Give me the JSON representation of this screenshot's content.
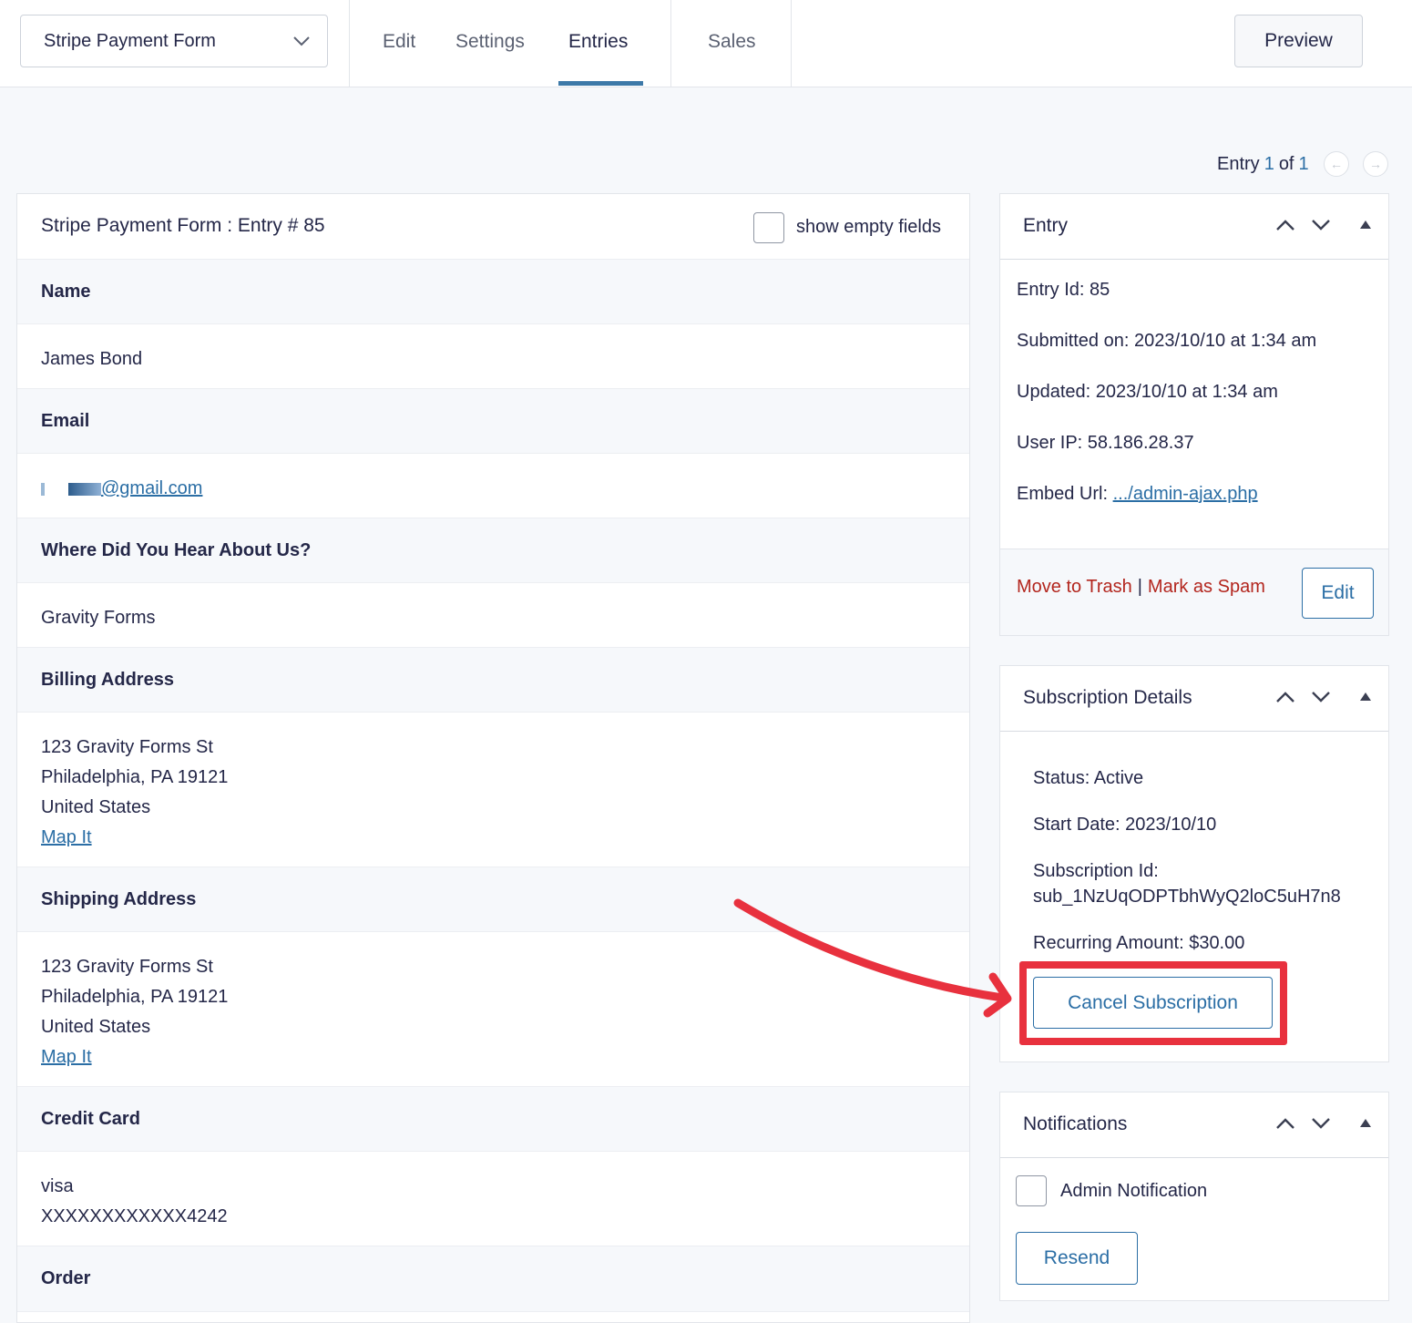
{
  "header": {
    "form_selector": "Stripe Payment Form",
    "tabs": [
      "Edit",
      "Settings",
      "Entries",
      "Sales"
    ],
    "active_tab": "Entries",
    "preview_label": "Preview"
  },
  "pager": {
    "prefix": "Entry",
    "current": "1",
    "of_label": "of",
    "total": "1"
  },
  "entry_card": {
    "title": "Stripe Payment Form : Entry # 85",
    "show_empty_label": "show empty fields",
    "fields": {
      "name_label": "Name",
      "name_value": "James Bond",
      "email_label": "Email",
      "email_value": "@gmail.com",
      "hear_label": "Where Did You Hear About Us?",
      "hear_value": "Gravity Forms",
      "billing_label": "Billing Address",
      "billing_line1": "123 Gravity Forms St",
      "billing_line2": "Philadelphia, PA 19121",
      "billing_line3": "United States",
      "billing_map": "Map It",
      "shipping_label": "Shipping Address",
      "shipping_line1": "123 Gravity Forms St",
      "shipping_line2": "Philadelphia, PA 19121",
      "shipping_line3": "United States",
      "shipping_map": "Map It",
      "card_label": "Credit Card",
      "card_type": "visa",
      "card_number": "XXXXXXXXXXXX4242",
      "order_label": "Order"
    }
  },
  "entry_panel": {
    "title": "Entry",
    "entry_id": "Entry Id: 85",
    "submitted": "Submitted on: 2023/10/10 at 1:34 am",
    "updated": "Updated: 2023/10/10 at 1:34 am",
    "user_ip": "User IP: 58.186.28.37",
    "embed_prefix": "Embed Url:",
    "embed_link": ".../admin-ajax.php",
    "trash": "Move to Trash",
    "separator": "|",
    "spam": "Mark as Spam",
    "edit": "Edit"
  },
  "subscription_panel": {
    "title": "Subscription Details",
    "status": "Status: Active",
    "start_date": "Start Date: 2023/10/10",
    "sub_id_label": "Subscription Id:",
    "sub_id_value": "sub_1NzUqODPTbhWyQ2loC5uH7n8",
    "recurring": "Recurring Amount: $30.00",
    "cancel": "Cancel Subscription"
  },
  "notifications_panel": {
    "title": "Notifications",
    "admin_notification": "Admin Notification",
    "resend": "Resend"
  },
  "colors": {
    "accent": "#2b6ea5",
    "danger": "#b3261e",
    "annotation": "#e8313e"
  }
}
